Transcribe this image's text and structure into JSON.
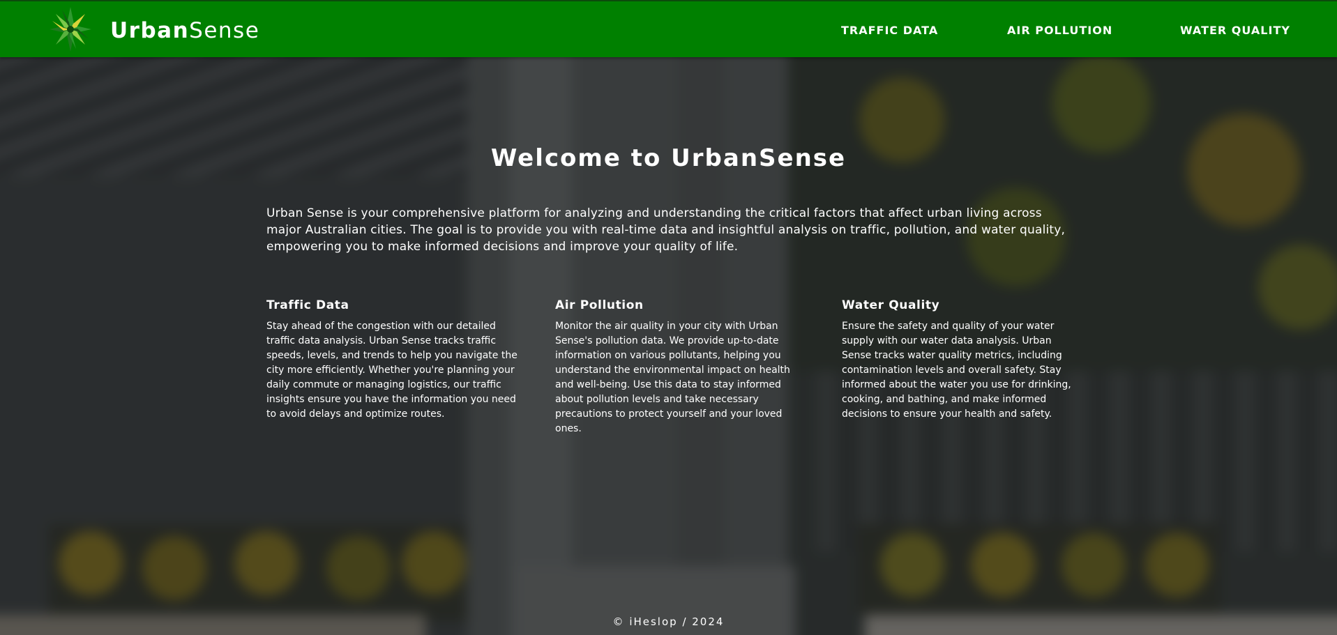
{
  "header": {
    "brand_bold": "Urban",
    "brand_light": "Sense",
    "nav": {
      "traffic": "TRAFFIC DATA",
      "air": "AIR POLLUTION",
      "water": "WATER QUALITY"
    }
  },
  "main": {
    "welcome_prefix": "Welcome to ",
    "welcome_bold": "Urban",
    "welcome_light": "Sense",
    "intro": "Urban Sense is your comprehensive platform for analyzing and understanding the critical factors that affect urban living across major Australian cities. The goal is to provide you with real-time data and insightful analysis on traffic, pollution, and water quality, empowering you to make informed decisions and improve your quality of life.",
    "cards": [
      {
        "title_bold": "Traffic",
        "title_light": " Data",
        "body": "Stay ahead of the congestion with our detailed traffic data analysis. Urban Sense tracks traffic speeds, levels, and trends to help you navigate the city more efficiently. Whether you're planning your daily commute or managing logistics, our traffic insights ensure you have the information you need to avoid delays and optimize routes."
      },
      {
        "title_bold": "Air",
        "title_light": " Pollution",
        "body": "Monitor the air quality in your city with Urban Sense's pollution data. We provide up-to-date information on various pollutants, helping you understand the environmental impact on health and well-being. Use this data to stay informed about pollution levels and take necessary precautions to protect yourself and your loved ones."
      },
      {
        "title_bold": "Water",
        "title_light": " Quality",
        "body": "Ensure the safety and quality of your water supply with our water data analysis. Urban Sense tracks water quality metrics, including contamination levels and overall safety. Stay informed about the water you use for drinking, cooking, and bathing, and make informed decisions to ensure your health and safety."
      }
    ]
  },
  "footer": {
    "text": "© iHeslop / 2024"
  },
  "icons": {
    "logo": "leaf-star-logo-icon"
  },
  "colors": {
    "header_green": "#008000",
    "text": "#ffffff"
  }
}
